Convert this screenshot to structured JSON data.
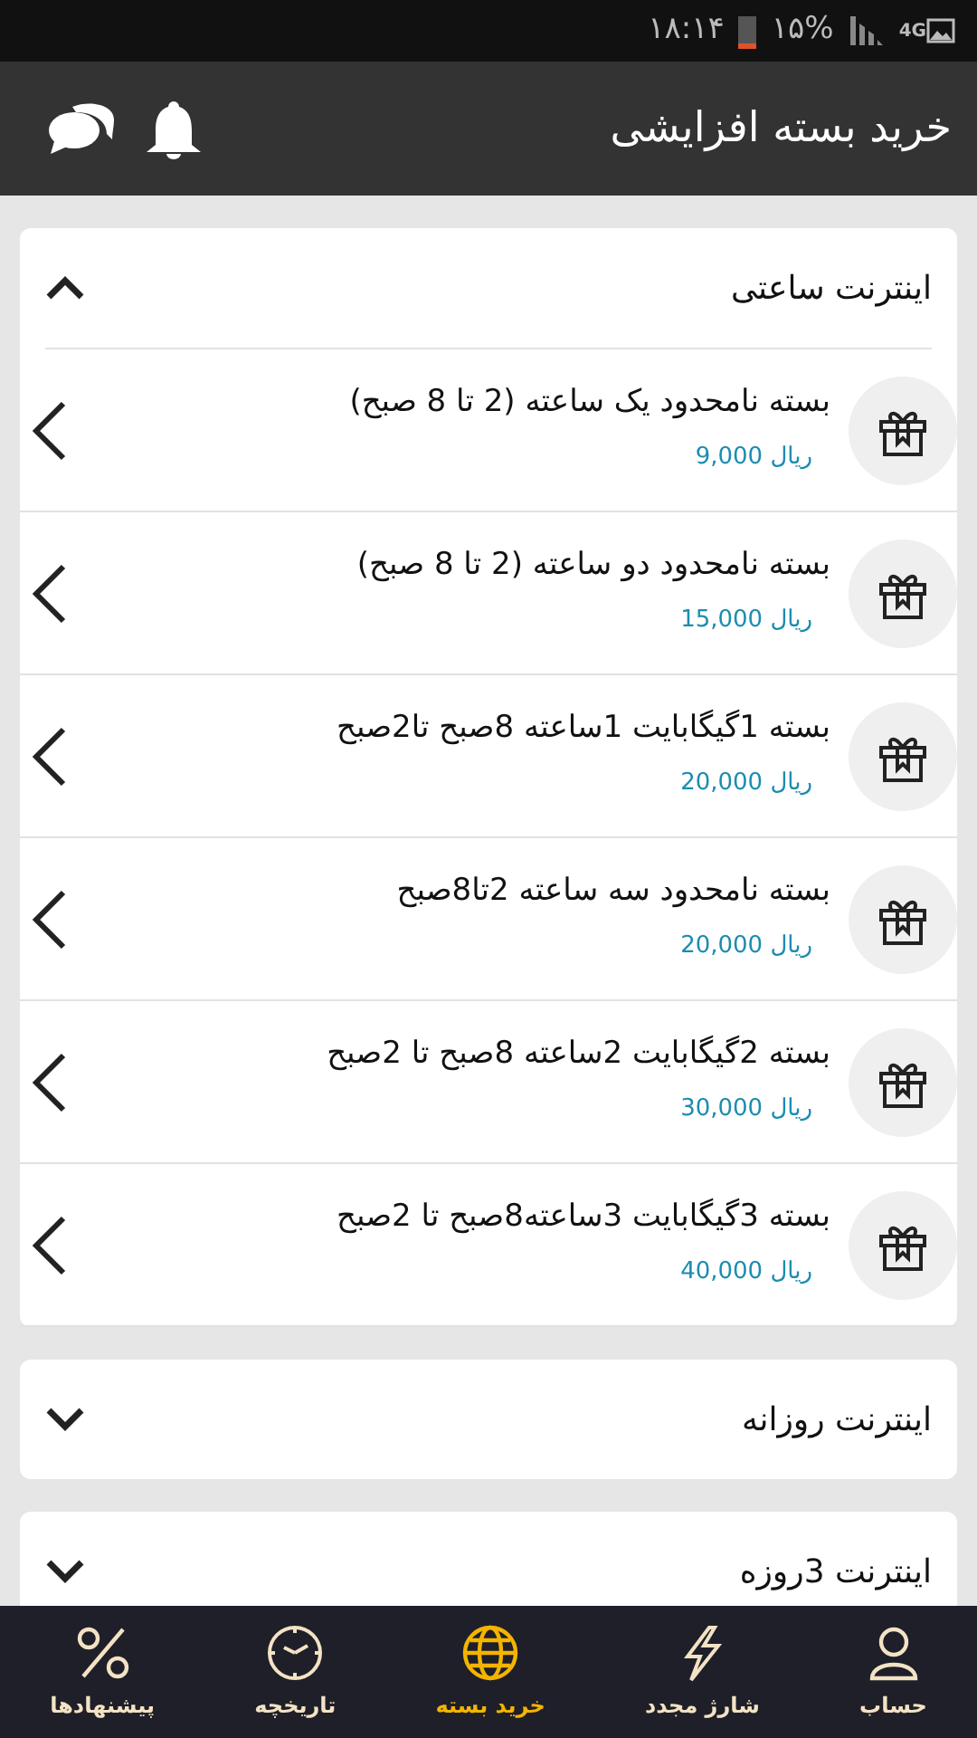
{
  "status_bar": {
    "time": "۱۸:۱۴",
    "battery": "۱۵%",
    "network": "4G"
  },
  "app_bar": {
    "title": "خرید بسته افزایشی"
  },
  "sections": [
    {
      "title": "اینترنت ساعتی",
      "expanded": true,
      "items": [
        {
          "title": "بسته نامحدود یک ساعته (2 تا 8 صبح)",
          "price": "ریال 9,000"
        },
        {
          "title": "بسته نامحدود دو ساعته (2 تا 8 صبح)",
          "price": "ریال 15,000"
        },
        {
          "title": "بسته 1گیگابایت 1ساعته 8صبح تا2صبح",
          "price": "ریال 20,000"
        },
        {
          "title": "بسته نامحدود سه ساعته 2تا8صبح",
          "price": "ریال 20,000"
        },
        {
          "title": "بسته 2گیگابایت 2ساعته 8صبح تا 2صبح",
          "price": "ریال 30,000"
        },
        {
          "title": "بسته 3گیگابایت 3ساعته8صبح تا 2صبح",
          "price": "ریال 40,000"
        }
      ]
    },
    {
      "title": "اینترنت روزانه",
      "expanded": false
    },
    {
      "title": "اینترنت 3روزه",
      "expanded": false
    }
  ],
  "bottom_nav": [
    {
      "kind": "account",
      "label": "حساب",
      "selected": false
    },
    {
      "kind": "recharge",
      "label": "شارژ مجدد",
      "selected": false
    },
    {
      "kind": "buy",
      "label": "خرید بسته",
      "selected": true
    },
    {
      "kind": "history",
      "label": "تاریخچه",
      "selected": false
    },
    {
      "kind": "offers",
      "label": "پیشنهادها",
      "selected": false
    }
  ]
}
